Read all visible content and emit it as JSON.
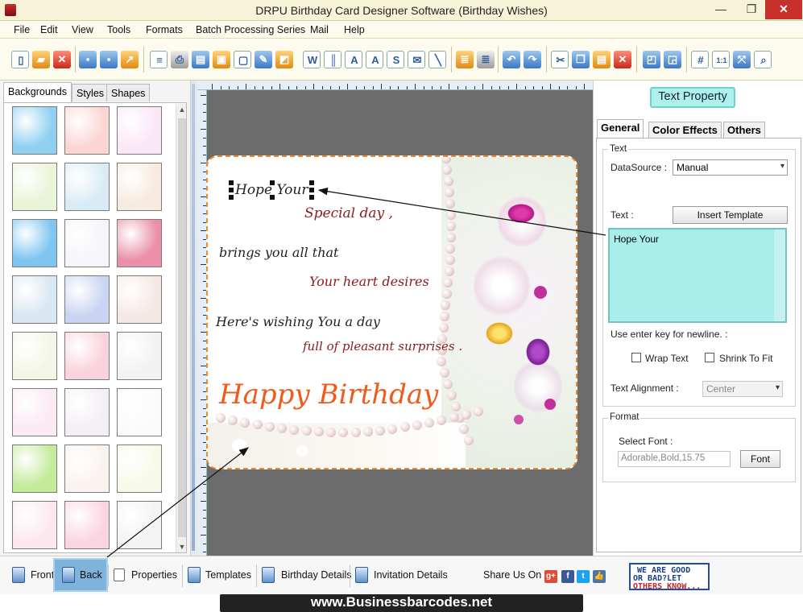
{
  "window": {
    "title": "DRPU Birthday Card Designer Software (Birthday Wishes)",
    "minimize": "—",
    "maximize": "❐",
    "close": "✕"
  },
  "menu": [
    "File",
    "Edit",
    "View",
    "Tools",
    "Formats",
    "Batch Processing Series",
    "Mail",
    "Help"
  ],
  "left_panel": {
    "tabs": [
      "Backgrounds",
      "Styles",
      "Shapes"
    ],
    "active_tab": "Backgrounds",
    "thumbnail_colors": [
      "#8fd0f0",
      "#fbd5d2",
      "#fbe6f6",
      "#e9f4d8",
      "#d9ecf5",
      "#f7eadf",
      "#7ec5f0",
      "#f5f5fb",
      "#e990a8",
      "#d8e7f2",
      "#c8d4f2",
      "#f4e8e4",
      "#f3f6e6",
      "#f9d2dc",
      "#f2f2f2",
      "#fbe9f3",
      "#f4eef6",
      "#fbfbfb",
      "#c4eb9a",
      "#faf3ef",
      "#f7fae8",
      "#fbe8ef",
      "#fbd4e2",
      "#f3f3f3"
    ]
  },
  "card": {
    "lines": [
      {
        "text": "Hope Your",
        "color": "#222222"
      },
      {
        "text": "Special day ,",
        "color": "#8c1a1a"
      },
      {
        "text": "brings you all that",
        "color": "#1f1f1f"
      },
      {
        "text": "Your heart desires",
        "color": "#8c1a1a"
      },
      {
        "text": "Here's wishing You a day",
        "color": "#1f1f1f"
      },
      {
        "text": "full of pleasant surprises .",
        "color": "#8c1a1a"
      }
    ],
    "headline": "Happy Birthday",
    "headline_color": "#f05a1a"
  },
  "right_panel": {
    "title_button": "Text Property",
    "tabs": [
      "General",
      "Color Effects",
      "Others"
    ],
    "active_tab": "General",
    "text_group": {
      "title": "Text",
      "datasource_label": "DataSource :",
      "datasource_value": "Manual",
      "text_label": "Text :",
      "insert_template_button": "Insert Template",
      "text_value": "Hope Your",
      "newline_hint": "Use enter key for newline. :",
      "wrap_text_label": "Wrap Text",
      "shrink_to_fit_label": "Shrink To Fit",
      "alignment_label": "Text Alignment :",
      "alignment_value": "Center"
    },
    "format_group": {
      "title": "Format",
      "select_font_label": "Select Font :",
      "font_value": "Adorable,Bold,15.75",
      "font_button": "Font"
    }
  },
  "bottom_bar": {
    "front": "Front",
    "back": "Back",
    "properties": "Properties",
    "templates": "Templates",
    "birthday_details": "Birthday Details",
    "invitation_details": "Invitation Details",
    "share_label": "Share Us On :",
    "feedback_line1": "WE ARE GOOD",
    "feedback_line2": "OR BAD?LET",
    "feedback_line3": "OTHERS KNOW...",
    "social_icons": [
      "g+",
      "f",
      "t",
      "👍"
    ]
  },
  "watermark": "www.Businessbarcodes.net",
  "accent_colors": {
    "text_area": "#aaeeec",
    "card_border": "#f08a2a",
    "close_button": "#c7302b"
  }
}
